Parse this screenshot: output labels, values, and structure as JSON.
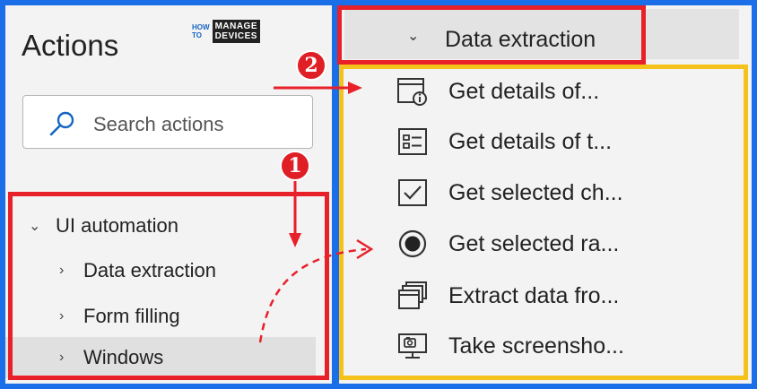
{
  "left_panel": {
    "title": "Actions",
    "logo": {
      "how_to": [
        "HOW",
        "TO"
      ],
      "manage": "MANAGE",
      "devices": "DEVICES"
    },
    "search": {
      "placeholder": "Search actions"
    },
    "tree": [
      {
        "label": "UI automation",
        "expanded": true,
        "level": 0
      },
      {
        "label": "Data extraction",
        "expanded": false,
        "level": 1
      },
      {
        "label": "Form filling",
        "expanded": false,
        "level": 1
      },
      {
        "label": "Windows",
        "expanded": false,
        "level": 1,
        "selected": true
      }
    ]
  },
  "badges": {
    "one": "1",
    "two": "2"
  },
  "right_panel": {
    "header": "Data extraction",
    "items": [
      {
        "label": "Get details of...",
        "icon": "window-info-icon"
      },
      {
        "label": "Get details of t...",
        "icon": "details-list-icon"
      },
      {
        "label": "Get selected ch...",
        "icon": "checkbox-icon"
      },
      {
        "label": "Get selected ra...",
        "icon": "radio-button-icon"
      },
      {
        "label": "Extract data fro...",
        "icon": "stacked-windows-icon"
      },
      {
        "label": "Take screensho...",
        "icon": "screenshot-icon"
      }
    ]
  },
  "colors": {
    "red": "#e8202a",
    "yellow": "#f5c21b",
    "blue_frame": "#1a6fe8"
  }
}
